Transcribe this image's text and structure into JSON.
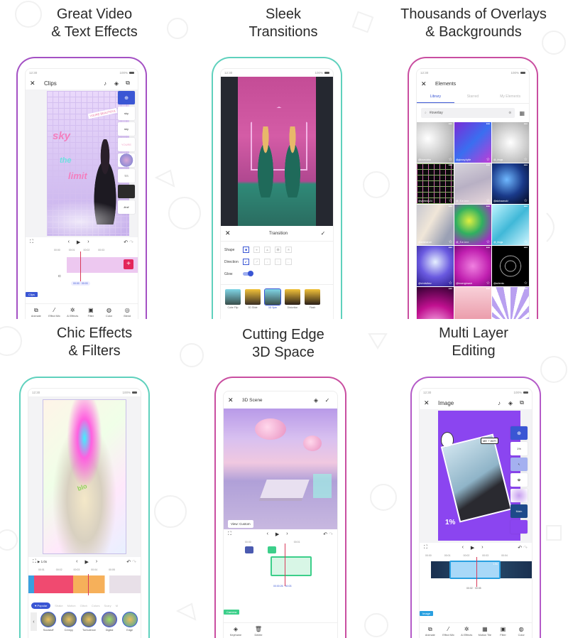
{
  "panels": [
    {
      "heading_line1": "Great Video",
      "heading_line2": "& Text Effects",
      "accent_color": "#a451c4",
      "status_time": "12:30",
      "status_battery": "100%",
      "screen_title": "Clips",
      "side_items": [
        "add-element",
        "sky",
        "sky",
        "youre-beautiful",
        "cloud",
        "drops",
        "photo",
        "limit"
      ],
      "side_labels": [
        "",
        "sky",
        "sky",
        "YOURE",
        "",
        "",
        "",
        "limit"
      ],
      "sticker_text": "YOURE BEAUTIFUL",
      "canvas_words": [
        "sky",
        "the",
        "limit"
      ],
      "ruler": [
        "00:00",
        "00:01",
        "00:02",
        "00:03"
      ],
      "time_readout": "00:00 · 00:03",
      "clip_tag": "Clips",
      "tools": [
        "Animate",
        "Effect Mix",
        "AI Effects",
        "Filter",
        "Color",
        "Blend"
      ]
    },
    {
      "heading_line1": "Sleek",
      "heading_line2": "Transitions",
      "status_time": "12:30",
      "status_battery": "100%",
      "dialog_title": "Transition",
      "shape_label": "Shape",
      "direction_label": "Direction",
      "glow_label": "Glow",
      "glow_on": true,
      "transitions": [
        "Cube Flip",
        "3D Slide",
        "3D Spin",
        "Distortion",
        "Flash"
      ],
      "selected_transition": "3D Spin"
    },
    {
      "heading_line1": "Thousands of Overlays",
      "heading_line2": "& Backgrounds",
      "status_time": "12:30",
      "status_battery": "100%",
      "screen_title": "Elements",
      "tabs": [
        "Library",
        "Starred",
        "My Elements"
      ],
      "active_tab": "Library",
      "search_value": "#overlay",
      "authors": [
        "@lovevolvs",
        "@glossy.kylie",
        "@_frogs",
        "@yeeted124",
        "@_S.e.l.e.n",
        "@alohaanuki",
        "@artsharom",
        "@_S.e.l.e.n",
        "@_frogs",
        "@vividvibez",
        "@lewerglowstr",
        "@artemis",
        "",
        "",
        ""
      ]
    },
    {
      "heading_line1": "Chic Effects",
      "heading_line2": "& Filters",
      "status_time": "12:30",
      "status_battery": "100%",
      "speed": "1.0x",
      "ruler": [
        "00:01",
        "00:02",
        "00:03",
        "00:04",
        "00:05"
      ],
      "categories": [
        "Popular",
        "Shake",
        "Motion",
        "Glitch",
        "Colors",
        "Scary",
        "M"
      ],
      "active_category": "Popular",
      "effects": [
        "Soulstuff",
        "Creepy",
        "Turbulence",
        "Digital",
        "Edge"
      ]
    },
    {
      "heading_line1": "Cutting Edge",
      "heading_line2": "3D Space",
      "screen_title": "3D Scene",
      "view_label": "View: Custom",
      "ruler": [
        "00:00",
        "00:01"
      ],
      "time_readout": "00:00:26 · 00:03",
      "clip_tag": "Camera",
      "tools": [
        "Keyframe",
        "Delete"
      ]
    },
    {
      "heading_line1": "Multi Layer",
      "heading_line2": "Editing",
      "status_time": "12:30",
      "status_battery": "100%",
      "screen_title": "Image",
      "sticker_text": "ME + WIFI",
      "battery_sticker": "1%",
      "main_label": "Main",
      "ruler": [
        "00:00",
        "00:01",
        "00:02",
        "00:03",
        "00:04"
      ],
      "clip_duration": "1.9s",
      "time_readout": "00:02 · 00:05",
      "clip_tag": "Image",
      "tools": [
        "Animate",
        "Effect Mix",
        "AI Effects",
        "Motion Tile",
        "Filter",
        "Color"
      ]
    }
  ]
}
